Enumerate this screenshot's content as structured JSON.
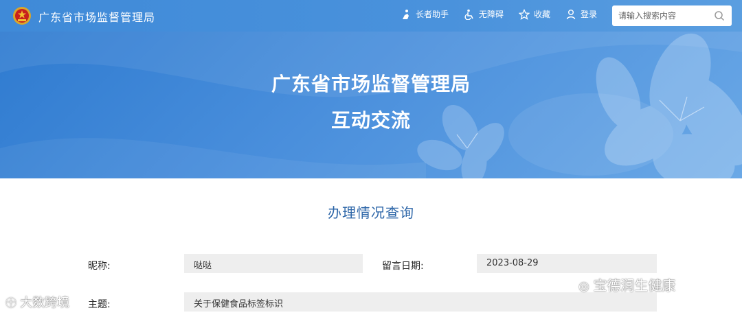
{
  "header": {
    "site_name": "广东省市场监督管理局",
    "tools": [
      {
        "label": "长者助手",
        "icon": "elder-assistant-icon"
      },
      {
        "label": "无障碍",
        "icon": "accessibility-icon"
      },
      {
        "label": "收藏",
        "icon": "star-icon"
      },
      {
        "label": "登录",
        "icon": "user-icon"
      }
    ],
    "search": {
      "placeholder": "请输入搜索内容",
      "icon": "search-icon"
    }
  },
  "banner": {
    "title_line1": "广东省市场监督管理局",
    "title_line2": "互动交流"
  },
  "main": {
    "section_title": "办理情况查询",
    "form": {
      "nickname_label": "昵称:",
      "nickname_value": "哒哒",
      "date_label": "留言日期:",
      "date_value": "2023-08-29",
      "subject_label": "主题:",
      "subject_value": "关于保健食品标签标识"
    }
  },
  "watermarks": {
    "left": "大数跨境",
    "right": "宝德润生健康"
  },
  "colors": {
    "header_blue": "#3f8ad8",
    "banner_blue": "#4a8fdc",
    "title_blue": "#2d66a8",
    "field_gray": "#eeeeee"
  }
}
